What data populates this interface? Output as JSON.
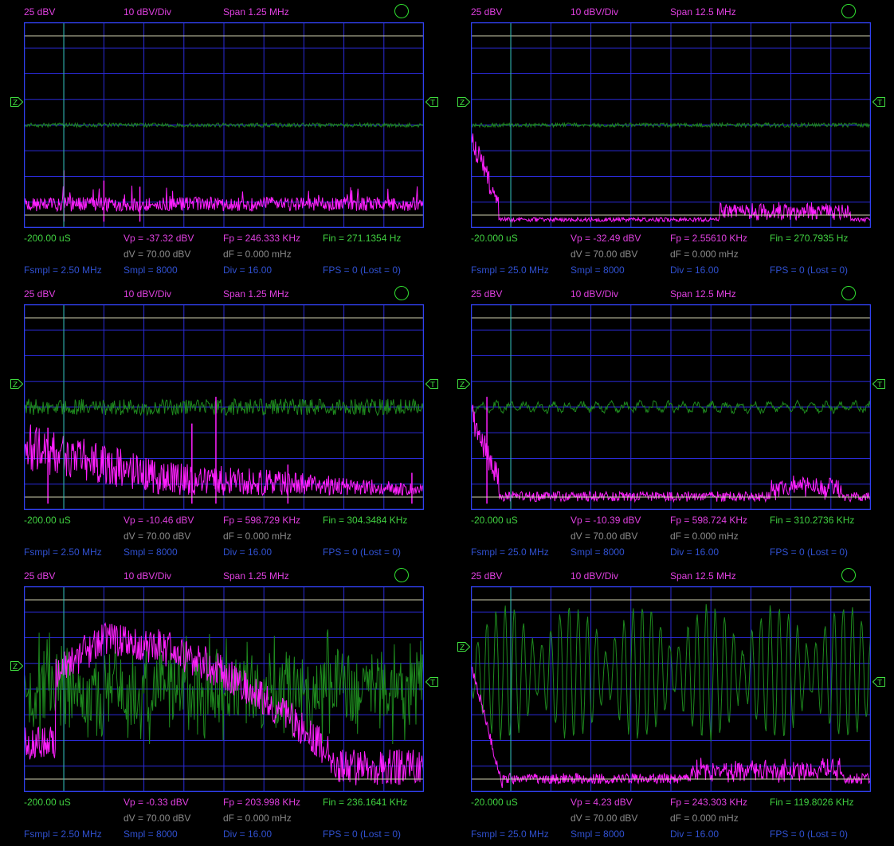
{
  "colors": {
    "background": "#000000",
    "grid": "#2a2ad8",
    "frame": "#3040f0",
    "spectrum": "#ff20ff",
    "waveform": "#1e8a1e",
    "marker_line": "#30c0a0",
    "ref_line": "#d0d0b0",
    "label_magenta": "#e040e0",
    "label_green": "#40d040",
    "label_gray": "#8a8a8a",
    "label_blue": "#3050d0"
  },
  "panels": [
    {
      "ref": "25 dBV",
      "scale": "10 dBV/Div",
      "span": "Span 1.25 MHz",
      "time": "-200.00 uS",
      "vp": "Vp = -37.32 dBV",
      "fp": "Fp = 246.333 KHz",
      "fin": "Fin = 271.1354 Hz",
      "dv": "dV = 70.00 dBV",
      "df": "dF = 0.000 mHz",
      "fsmpl": "Fsmpl = 2.50 MHz",
      "smpl": "Smpl = 8000",
      "div": "Div = 16.00",
      "fps": "FPS = 0 (Lost = 0)",
      "wave": {
        "kind": "flat",
        "level": 0.5,
        "amp": 0.01
      },
      "spectrum": {
        "kind": "noise-low",
        "base": 0.92,
        "spread": 0.07,
        "peaks": [
          [
            0.1,
            0.72
          ],
          [
            0.2,
            0.77
          ],
          [
            0.29,
            0.8
          ]
        ],
        "hump": null
      }
    },
    {
      "ref": "25 dBV",
      "scale": "10 dBV/Div",
      "span": "Span 12.5 MHz",
      "time": "-20.000 uS",
      "vp": "Vp = -32.49 dBV",
      "fp": "Fp = 2.55610 KHz",
      "fin": "Fin = 270.7935 Hz",
      "dv": "dV = 70.00 dBV",
      "df": "dF = 0.000 mHz",
      "fsmpl": "Fsmpl = 25.0 MHz",
      "smpl": "Smpl = 8000",
      "div": "Div = 16.00",
      "fps": "FPS = 0 (Lost = 0)",
      "wave": {
        "kind": "flat",
        "level": 0.5,
        "amp": 0.01
      },
      "spectrum": {
        "kind": "decay",
        "base": 0.97,
        "spread": 0.02,
        "peaks": [],
        "hump": [
          0.62,
          0.95,
          0.9
        ]
      }
    },
    {
      "ref": "25 dBV",
      "scale": "10 dBV/Div",
      "span": "Span 1.25 MHz",
      "time": "-200.00 uS",
      "vp": "Vp = -10.46 dBV",
      "fp": "Fp = 598.729 KHz",
      "fin": "Fin = 304.3484 KHz",
      "dv": "dV = 70.00 dBV",
      "df": "dF = 0.000 mHz",
      "fsmpl": "Fsmpl = 2.50 MHz",
      "smpl": "Smpl = 8000",
      "div": "Div = 16.00",
      "fps": "FPS = 0 (Lost = 0)",
      "wave": {
        "kind": "flat",
        "level": 0.5,
        "amp": 0.04
      },
      "spectrum": {
        "kind": "slope",
        "base": 0.93,
        "spread": 0.18,
        "peaks": [
          [
            0.48,
            0.45
          ],
          [
            0.42,
            0.58
          ],
          [
            0.06,
            0.6
          ],
          [
            0.66,
            0.78
          ],
          [
            0.97,
            0.82
          ]
        ],
        "hump": null
      }
    },
    {
      "ref": "25 dBV",
      "scale": "10 dBV/Div",
      "span": "Span 12.5 MHz",
      "time": "-20.000 uS",
      "vp": "Vp = -10.39 dBV",
      "fp": "Fp = 598.724 KHz",
      "fin": "Fin = 310.2736 KHz",
      "dv": "dV = 70.00 dBV",
      "df": "dF = 0.000 mHz",
      "fsmpl": "Fsmpl = 25.0 MHz",
      "smpl": "Smpl = 8000",
      "div": "Div = 16.00",
      "fps": "FPS = 0 (Lost = 0)",
      "wave": {
        "kind": "wobble",
        "level": 0.5,
        "amp": 0.03
      },
      "spectrum": {
        "kind": "decay",
        "base": 0.96,
        "spread": 0.05,
        "peaks": [
          [
            0.04,
            0.45
          ]
        ],
        "hump": [
          0.75,
          0.93,
          0.85
        ]
      }
    },
    {
      "ref": "25 dBV",
      "scale": "10 dBV/Div",
      "span": "Span 1.25 MHz",
      "time": "-200.00 uS",
      "vp": "Vp = -0.33 dBV",
      "fp": "Fp = 203.998 KHz",
      "fin": "Fin = 236.1641 KHz",
      "dv": "dV = 70.00 dBV",
      "df": "dF = 0.000 mHz",
      "fsmpl": "Fsmpl = 2.50 MHz",
      "smpl": "Smpl = 8000",
      "div": "Div = 16.00",
      "fps": "FPS = 0 (Lost = 0)",
      "wave": {
        "kind": "dense",
        "level": 0.5,
        "amp": 0.25
      },
      "spectrum": {
        "kind": "bell",
        "base": 0.97,
        "spread": 0.08,
        "peaks": [],
        "hump": null
      }
    },
    {
      "ref": "25 dBV",
      "scale": "10 dBV/Div",
      "span": "Span 12.5 MHz",
      "time": "-20.000 uS",
      "vp": "Vp = 4.23 dBV",
      "fp": "Fp = 243.303 KHz",
      "fin": "Fin = 119.8026 KHz",
      "dv": "dV = 70.00 dBV",
      "df": "dF = 0.000 mHz",
      "fsmpl": "Fsmpl = 25.0 MHz",
      "smpl": "Smpl = 8000",
      "div": "Div = 16.00",
      "fps": "FPS = 0 (Lost = 0)",
      "wave": {
        "kind": "osc",
        "level": 0.42,
        "amp": 0.32
      },
      "spectrum": {
        "kind": "spike-left",
        "base": 0.96,
        "spread": 0.05,
        "peaks": [],
        "hump": [
          0.55,
          0.93,
          0.9
        ]
      }
    }
  ]
}
